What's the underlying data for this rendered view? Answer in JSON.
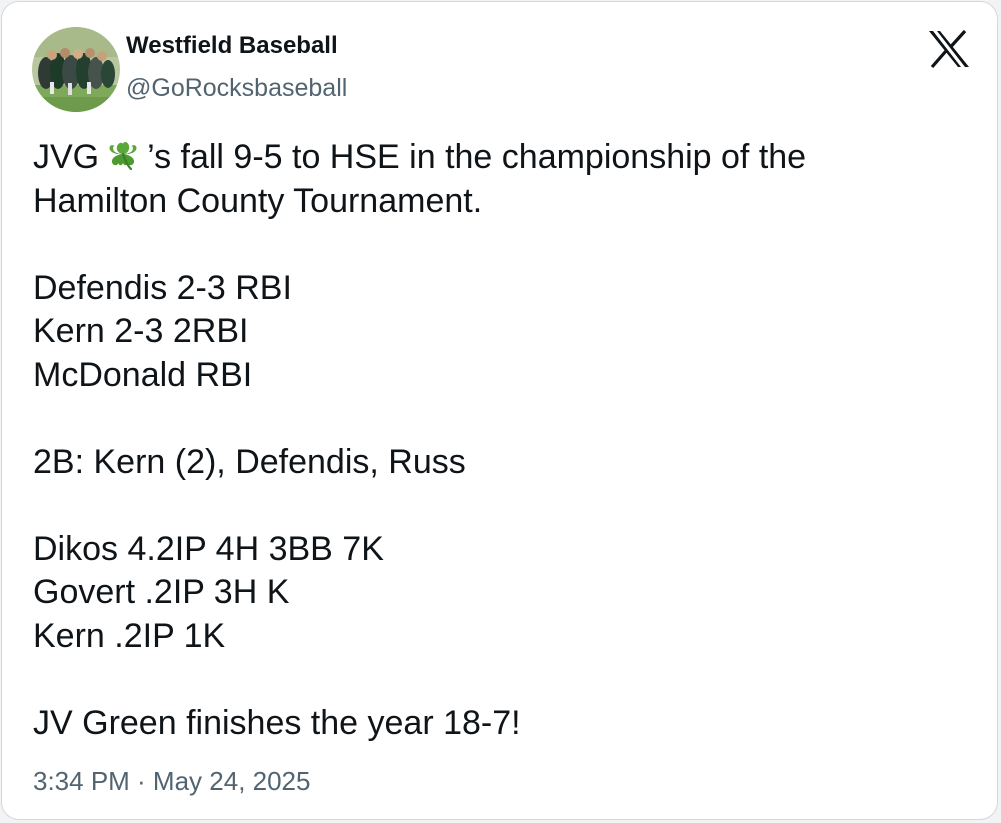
{
  "author": {
    "display_name": "Westfield Baseball",
    "handle": "@GoRocksbaseball"
  },
  "platform_logo_icon": "x-logo-icon",
  "tweet": {
    "line1_pre": "JVG",
    "line1_emoji": "shamrock-emoji",
    "line1_post": "’s fall 9-5 to HSE in the championship of the",
    "line2": "Hamilton County Tournament.",
    "line3": "Defendis 2-3 RBI",
    "line4": "Kern 2-3 2RBI",
    "line5": "McDonald RBI",
    "line6": "2B: Kern (2), Defendis, Russ",
    "line7": "Dikos 4.2IP 4H 3BB 7K",
    "line8": "Govert .2IP 3H K",
    "line9": "Kern .2IP 1K",
    "line10": "JV Green finishes the year 18-7!"
  },
  "timestamp": "3:34 PM · May 24, 2025",
  "colors": {
    "text_primary": "#0f1419",
    "text_secondary": "#536471",
    "shamrock": "#5aa83a",
    "border": "#d4d8dc"
  }
}
